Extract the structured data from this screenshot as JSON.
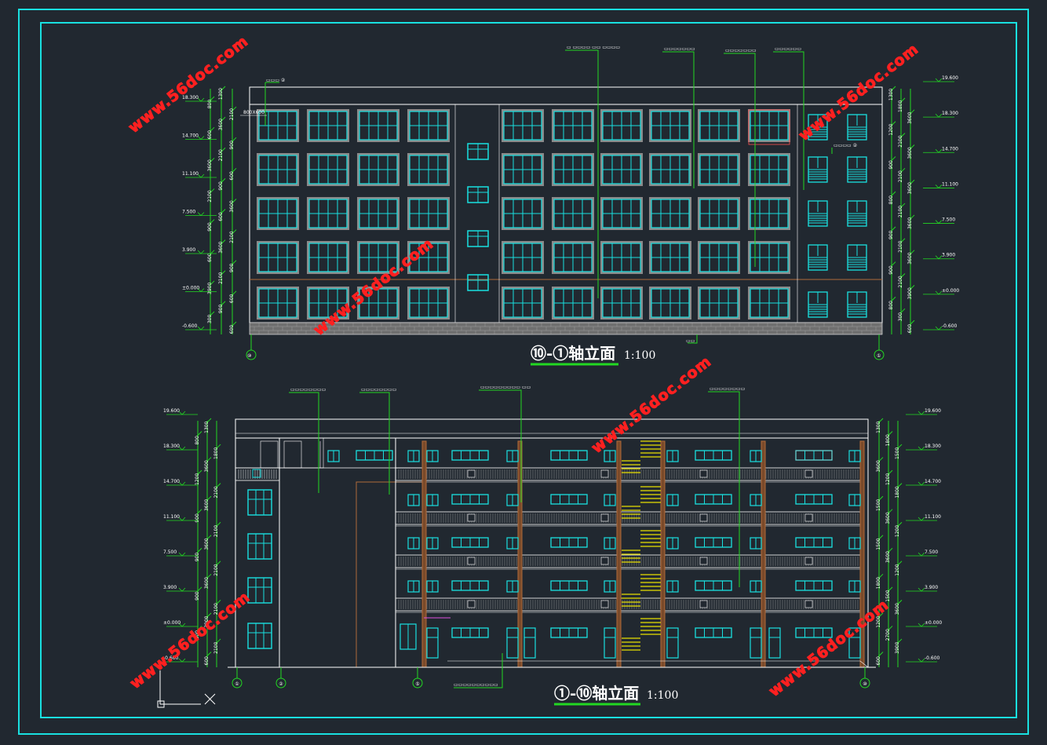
{
  "drawings": {
    "top": {
      "title": "⑩-①轴立面",
      "scale": "1:100",
      "left_axis": "⑩",
      "right_axis": "①",
      "left_levels": [
        "18.300",
        "14.700",
        "11.100",
        "7.500",
        "3.900",
        "±0.000",
        "-0.600"
      ],
      "right_levels": [
        "19.600",
        "18.300",
        "14.700",
        "11.100",
        "7.500",
        "3.900",
        "±0.000",
        "-0.600"
      ],
      "left_dims": [
        "1300",
        "800",
        "2100",
        "3600",
        "600",
        "900",
        "2100",
        "3600",
        "600",
        "900",
        "2100",
        "3600",
        "600",
        "900",
        "2100",
        "3600",
        "600",
        "900",
        "2100",
        "3900",
        "600",
        "900",
        "300",
        "600"
      ],
      "right_dims": [
        "1300",
        "1800",
        "3600",
        "1200",
        "2100",
        "3600",
        "900",
        "2100",
        "3600",
        "800",
        "2100",
        "3600",
        "900",
        "2100",
        "3600",
        "900",
        "2100",
        "3900",
        "800",
        "300",
        "600"
      ],
      "label_window": "800X600"
    },
    "bottom": {
      "title": "①-⑩轴立面",
      "scale": "1:100",
      "axes": [
        "①",
        "②",
        "⑤",
        "⑩"
      ],
      "left_levels": [
        "19.600",
        "18.300",
        "14.700",
        "11.100",
        "7.500",
        "3.900",
        "±0.000",
        "-0.600"
      ],
      "right_levels": [
        "19.600",
        "18.300",
        "14.700",
        "11.100",
        "7.500",
        "3.900",
        "±0.000",
        "-0.600"
      ],
      "left_dims": [
        "1300",
        "800",
        "1800",
        "3600",
        "1200",
        "2100",
        "3600",
        "900",
        "2100",
        "3600",
        "900",
        "2100",
        "3600",
        "900",
        "2100",
        "3900",
        "900",
        "2100",
        "600"
      ],
      "right_dims": [
        "1300",
        "1800",
        "1500",
        "3600",
        "1200",
        "1800",
        "1500",
        "3600",
        "1200",
        "1500",
        "3600",
        "1200",
        "1800",
        "1500",
        "3600",
        "1200",
        "2700",
        "3900",
        "600"
      ]
    }
  },
  "watermark": "www.56doc.com",
  "colors": {
    "background": "#212830",
    "frame": "#19e0e0",
    "lines": "#ffffff",
    "windows": "#19e0e0",
    "leaders": "#22d822",
    "brick": "#8a8a8a",
    "columns": "#b06a3a",
    "stair": "#e8e000",
    "watermark": "#ff2020",
    "title_underline": "#22d822"
  }
}
